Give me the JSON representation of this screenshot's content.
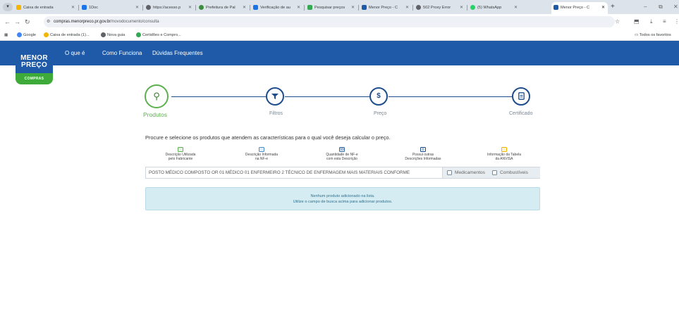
{
  "browser": {
    "tabs": [
      {
        "title": "Caixa de entrada",
        "color": "#f4b400"
      },
      {
        "title": "1Doc",
        "color": "#1a73e8"
      },
      {
        "title": "https://acesso.p",
        "color": "#5f6368"
      },
      {
        "title": "Prefeitura de Pal",
        "color": "#3c8d40"
      },
      {
        "title": "Verificação de au",
        "color": "#1a73e8"
      },
      {
        "title": "Pesquisar preços",
        "color": "#34a853"
      },
      {
        "title": "Menor Preço - C",
        "color": "#1e5aa8"
      },
      {
        "title": "502 Proxy Error",
        "color": "#5f6368"
      },
      {
        "title": "(5) WhatsApp",
        "color": "#25d366"
      },
      {
        "title": "Menor Preço - C",
        "color": "#1e5aa8"
      }
    ],
    "url_host": "compras.menorpreco.pr.gov.br",
    "url_path": "/novodocumento/consulta",
    "bookmarks": [
      {
        "label": "Google",
        "color": "#4285f4"
      },
      {
        "label": "Caixa de entrada (1)...",
        "color": "#f4b400"
      },
      {
        "label": "Nova guia",
        "color": "#5f6368"
      },
      {
        "label": "Certidões e Compro...",
        "color": "#34a853"
      }
    ],
    "all_bookmarks_label": "Todos os favoritos"
  },
  "site": {
    "logo_line1": "MENOR",
    "logo_line2": "PREÇO",
    "logo_sub": "COMPRAS",
    "nav": [
      "O que é",
      "Como Funciona",
      "Dúvidas Frequentes"
    ]
  },
  "steps": [
    {
      "label": "Produtos",
      "icon": "search-icon",
      "active": true
    },
    {
      "label": "Filtros",
      "icon": "filter-icon",
      "active": false
    },
    {
      "label": "Preço",
      "icon": "dollar-icon",
      "active": false
    },
    {
      "label": "Certificado",
      "icon": "document-icon",
      "active": false
    }
  ],
  "instructions": "Procure e selecione os produtos que atendem as características para o qual você deseja calcular o preço.",
  "legend": [
    {
      "line1": "Descrição Utilizada",
      "line2": "pelo Fabricante",
      "color": "#5db04f",
      "glyph": ""
    },
    {
      "line1": "Descrição Informada",
      "line2": "na NF-e",
      "color": "#4a90c8",
      "glyph": ""
    },
    {
      "line1": "Quantidade de NF-e",
      "line2": "com esta Descrição",
      "color": "#3a6ea5",
      "glyph": "99"
    },
    {
      "line1": "Possui outras",
      "line2": "Descrições Informadas",
      "color": "#1e4d8c",
      "glyph": "i"
    },
    {
      "line1": "Informação da Tabela",
      "line2": "da ANVISA",
      "color": "#f0b400",
      "glyph": ""
    }
  ],
  "search": {
    "value": "POSTO MÉDICO COMPOSTO OR 01 MÉDICO 01 ENFERMEIRO 2 TÉCNICO DE ENFERMAGEM MAIS MATERIAIS CONFORME"
  },
  "filters": {
    "medicamentos": "Medicamentos",
    "combustiveis": "Combustíveis"
  },
  "empty_state": {
    "line1": "Nenhum produto adicionado na lista.",
    "line2": "Utilize o campo de busca acima para adicionar produtos."
  }
}
